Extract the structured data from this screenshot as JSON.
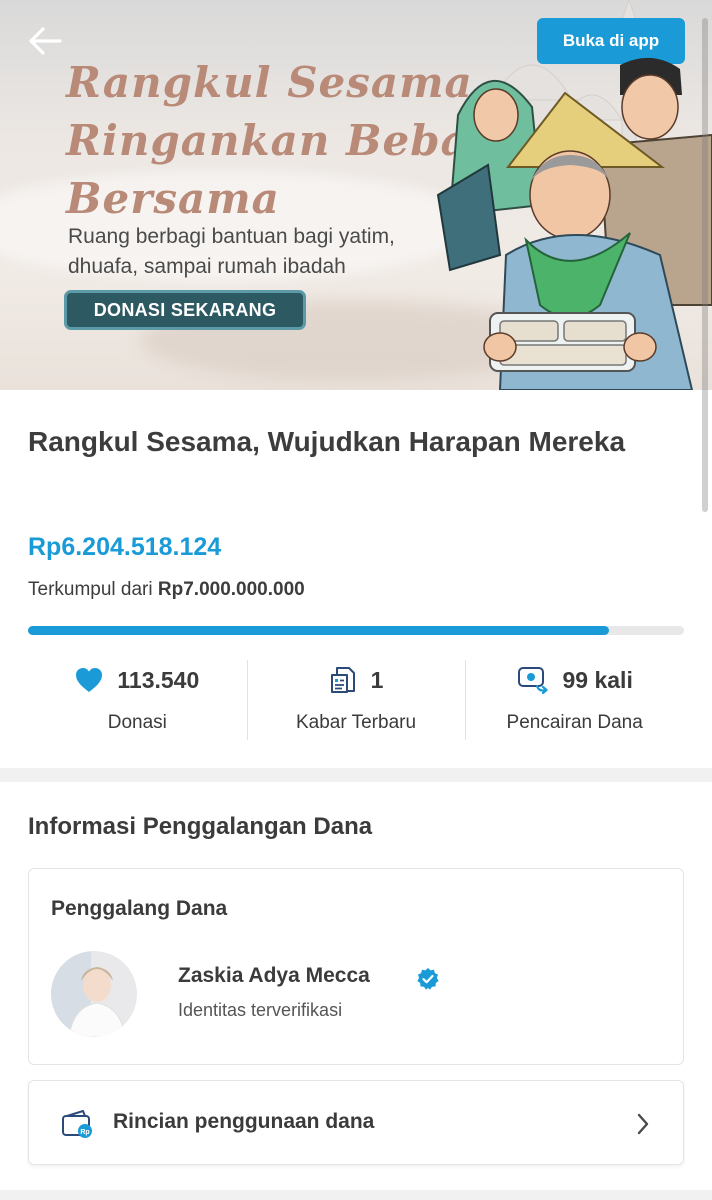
{
  "header": {
    "open_app_label": "Buka di app"
  },
  "banner": {
    "title_lines": [
      "Rangkul Sesama",
      "Ringankan Beban",
      "Bersama"
    ],
    "subtitle_lines": [
      "Ruang berbagi bantuan bagi yatim,",
      "dhuafa, sampai rumah ibadah"
    ],
    "cta_label": "DONASI SEKARANG"
  },
  "campaign": {
    "title": "Rangkul Sesama, Wujudkan Harapan Mereka",
    "raised": "Rp6.204.518.124",
    "target_prefix": "Terkumpul dari",
    "target": "Rp7.000.000.000",
    "progress_fraction": 0.886
  },
  "stats": [
    {
      "icon": "heart-icon",
      "value": "113.540",
      "label": "Donasi"
    },
    {
      "icon": "news-icon",
      "value": "1",
      "label": "Kabar Terbaru"
    },
    {
      "icon": "disbursement-icon",
      "value": "99 kali",
      "label": "Pencairan Dana"
    }
  ],
  "fundraising_info": {
    "section_title": "Informasi Penggalangan Dana",
    "card_title": "Penggalang Dana",
    "fundraiser_name": "Zaskia Adya Mecca",
    "verification_text": "Identitas terverifikasi",
    "usage_label": "Rincian penggunaan dana"
  },
  "colors": {
    "accent": "#1a9bd7",
    "cta_bg": "#2d5963",
    "banner_title": "#b88a77",
    "text": "#3b3b3b"
  }
}
